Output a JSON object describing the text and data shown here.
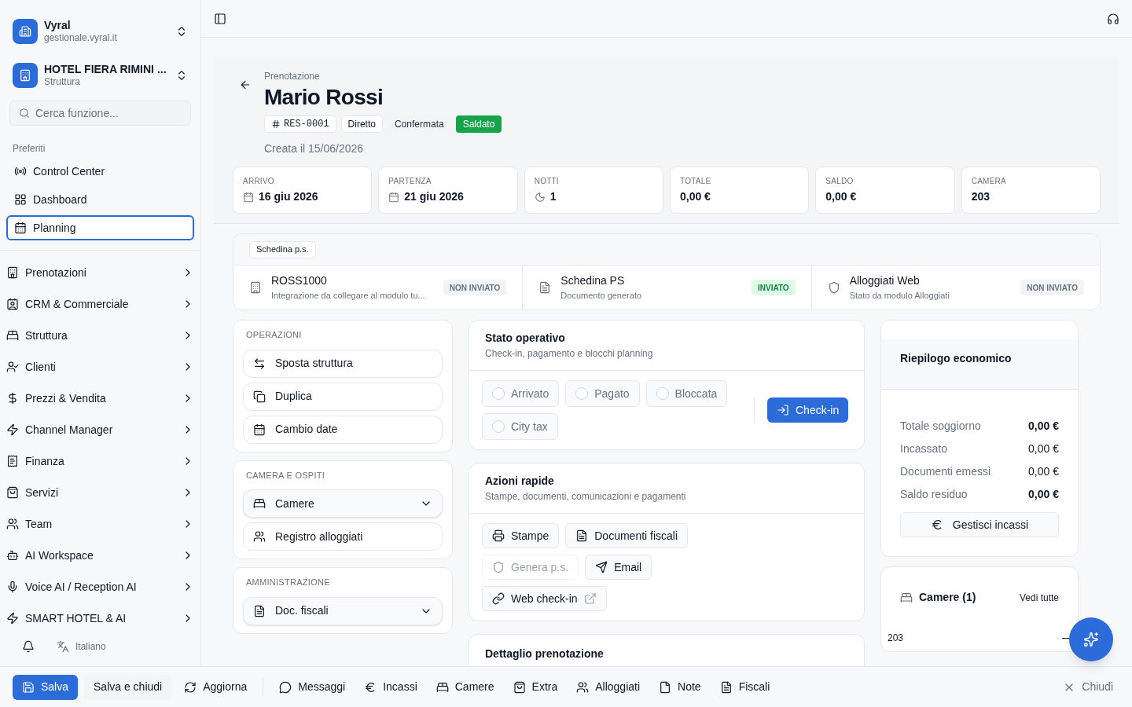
{
  "sidebar": {
    "org": {
      "name": "Vyral",
      "domain": "gestionale.vyral.it"
    },
    "property": {
      "name": "HOTEL FIERA RIMINI ...",
      "subtitle": "Struttura"
    },
    "search": {
      "placeholder": "Cerca funzione..."
    },
    "favorites_label": "Preferiti",
    "favorites": [
      {
        "label": "Control Center",
        "selected": false
      },
      {
        "label": "Dashboard",
        "selected": false
      },
      {
        "label": "Planning",
        "selected": true
      }
    ],
    "nav": [
      {
        "label": "Prenotazioni"
      },
      {
        "label": "CRM & Commerciale"
      },
      {
        "label": "Struttura"
      },
      {
        "label": "Clienti"
      },
      {
        "label": "Prezzi & Vendita"
      },
      {
        "label": "Channel Manager"
      },
      {
        "label": "Finanza"
      },
      {
        "label": "Servizi"
      },
      {
        "label": "Team"
      },
      {
        "label": "AI Workspace"
      },
      {
        "label": "Voice AI / Reception AI"
      },
      {
        "label": "SMART HOTEL & AI"
      }
    ],
    "language": "Italiano"
  },
  "reservation": {
    "eyebrow": "Prenotazione",
    "name": "Mario Rossi",
    "tags": [
      {
        "label": "RES-0001",
        "kind": "id"
      },
      {
        "label": "Diretto",
        "kind": "outline"
      },
      {
        "label": "Confermata",
        "kind": "muted"
      },
      {
        "label": "Saldato",
        "kind": "success"
      }
    ],
    "created": "Creata il 15/06/2026"
  },
  "stats": [
    {
      "label": "ARRIVO",
      "value": "16 giu 2026",
      "kind": "date"
    },
    {
      "label": "PARTENZA",
      "value": "21 giu 2026",
      "kind": "date"
    },
    {
      "label": "NOTTI",
      "value": "1",
      "kind": "nights"
    },
    {
      "label": "TOTALE",
      "value": "0,00 €",
      "kind": "plain"
    },
    {
      "label": "SALDO",
      "value": "0,00 €",
      "kind": "plain"
    },
    {
      "label": "CAMERA",
      "value": "203",
      "kind": "plain"
    }
  ],
  "schedina": {
    "tab": "Schedina p.s.",
    "items": [
      {
        "title": "ROSS1000",
        "subtitle": "Integrazione da collegare al modulo tu...",
        "status": "NON INVIATO",
        "sent": false
      },
      {
        "title": "Schedina PS",
        "subtitle": "Documento generato",
        "status": "INVIATO",
        "sent": true
      },
      {
        "title": "Alloggiati Web",
        "subtitle": "Stato da modulo Alloggiati",
        "status": "NON INVIATO",
        "sent": false
      }
    ]
  },
  "operations": {
    "title": "OPERAZIONI",
    "items": [
      {
        "label": "Sposta struttura"
      },
      {
        "label": "Duplica"
      },
      {
        "label": "Cambio date"
      }
    ]
  },
  "rooms_guests": {
    "title": "CAMERA E OSPITI",
    "items": [
      {
        "label": "Camere",
        "kind": "select"
      },
      {
        "label": "Registro alloggiati",
        "kind": "button"
      }
    ]
  },
  "admin": {
    "title": "AMMINISTRAZIONE",
    "items": [
      {
        "label": "Doc. fiscali",
        "kind": "select"
      }
    ]
  },
  "status_card": {
    "title": "Stato operativo",
    "subtitle": "Check-in, pagamento e blocchi planning",
    "toggles": [
      {
        "label": "Arrivato",
        "checked": false
      },
      {
        "label": "Pagato",
        "checked": false
      },
      {
        "label": "Bloccata",
        "checked": false
      },
      {
        "label": "City tax",
        "checked": false
      }
    ],
    "action": "Check-in"
  },
  "quick_actions": {
    "title": "Azioni rapide",
    "subtitle": "Stampe, documenti, comunicazioni e pagamenti",
    "buttons": [
      {
        "label": "Stampe",
        "disabled": false,
        "external": false
      },
      {
        "label": "Documenti fiscali",
        "disabled": false,
        "external": false
      },
      {
        "label": "Genera p.s.",
        "disabled": true,
        "external": false
      },
      {
        "label": "Email",
        "disabled": false,
        "external": false
      },
      {
        "label": "Web check-in",
        "disabled": false,
        "external": true
      }
    ]
  },
  "detail": {
    "title": "Dettaglio prenotazione"
  },
  "summary": {
    "title": "Riepilogo economico",
    "rows": [
      {
        "label": "Totale soggiorno",
        "value": "0,00 €",
        "bold": true
      },
      {
        "label": "Incassato",
        "value": "0,00 €",
        "bold": false
      },
      {
        "label": "Documenti emessi",
        "value": "0,00 €",
        "bold": false
      },
      {
        "label": "Saldo residuo",
        "value": "0,00 €",
        "bold": true
      }
    ],
    "button": "Gestisci incassi"
  },
  "rooms": {
    "title": "Camere (1)",
    "link": "Vedi tutte",
    "rows": [
      {
        "label": "203"
      }
    ]
  },
  "bottom_bar": {
    "primary": "Salva",
    "secondary": "Salva e chiudi",
    "actions": [
      {
        "label": "Aggiorna"
      },
      {
        "label": "Messaggi"
      },
      {
        "label": "Incassi"
      },
      {
        "label": "Camere"
      },
      {
        "label": "Extra"
      },
      {
        "label": "Alloggiati"
      },
      {
        "label": "Note"
      },
      {
        "label": "Fiscali"
      }
    ],
    "close": "Chiudi"
  }
}
